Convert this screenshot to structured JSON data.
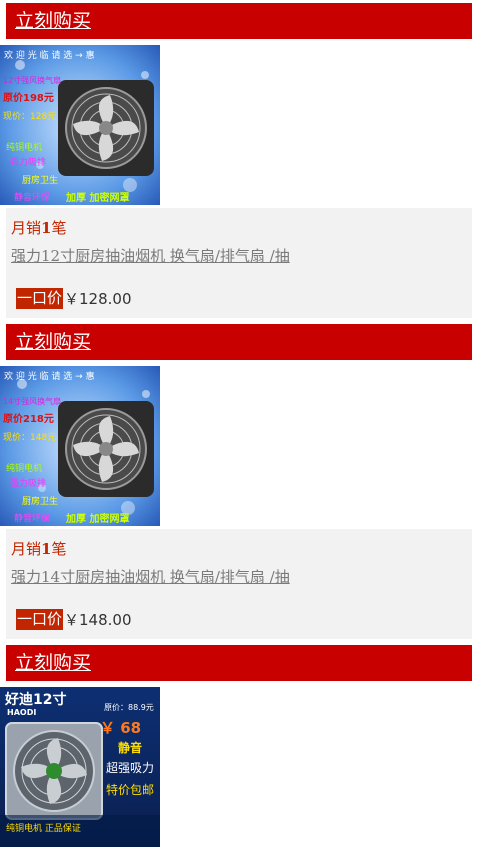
{
  "products": [
    {
      "buy_label": "立刻购买",
      "sales_prefix": "月销",
      "sales_count": "1",
      "sales_suffix": "笔",
      "title": "强力12寸厨房抽油烟机 换气扇/排气扇 /抽",
      "price_tag": "一口价",
      "price": "￥128.00",
      "thumb": {
        "top_text": "欢 迎 光 临   请 选 → 惠",
        "line1": "12寸强风换气扇",
        "line2": "原价198元",
        "line3": "现价：128元",
        "line4": "纯铜电机",
        "line5": "强力吸排",
        "line6": "厨房卫生",
        "line7": "静音环保",
        "line8": "加厚 加密网罩"
      }
    },
    {
      "buy_label": "立刻购买",
      "sales_prefix": "月销",
      "sales_count": "1",
      "sales_suffix": "笔",
      "title": "强力14寸厨房抽油烟机 换气扇/排气扇 /抽",
      "price_tag": "一口价",
      "price": "￥148.00",
      "thumb": {
        "top_text": "欢 迎 光 临   请 选 → 惠",
        "line1": "14寸强风换气扇",
        "line2": "原价218元",
        "line3": "现价：148元",
        "line4": "纯铜电机",
        "line5": "强力吸排",
        "line6": "厨房卫生",
        "line7": "静音环保",
        "line8": "加厚 加密网罩"
      }
    },
    {
      "buy_label": "立刻购买",
      "thumb": {
        "brand": "好迪12寸",
        "brand_en": "HAODI",
        "orig_price": "原价：88.9元",
        "price": "￥ 68",
        "tag1": "静音",
        "tag2": "超强吸力",
        "tag3": "特价包邮",
        "footer": "纯铜电机 正品保证"
      }
    }
  ],
  "colors": {
    "buy_bar": "#c90000",
    "info_bg": "#f2f2f2",
    "price_tag": "#c12600"
  }
}
